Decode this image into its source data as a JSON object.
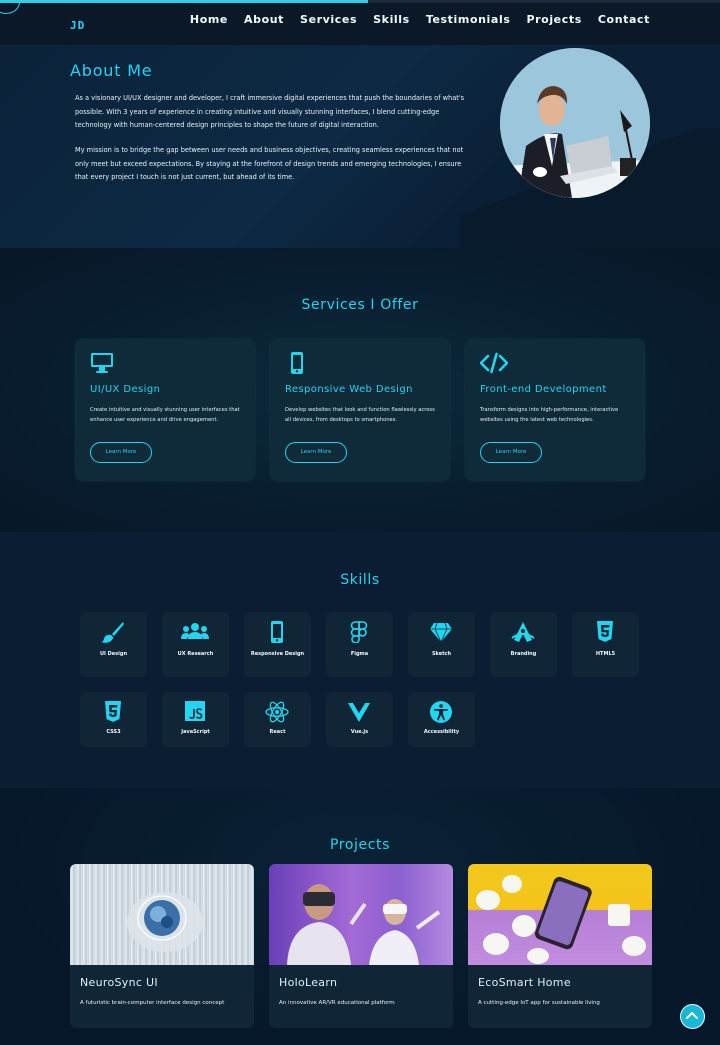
{
  "header": {
    "logo": "JD",
    "nav": [
      "Home",
      "About",
      "Services",
      "Skills",
      "Testimonials",
      "Projects",
      "Contact"
    ]
  },
  "about": {
    "title": "About Me",
    "p1": "As a visionary UI/UX designer and developer, I craft immersive digital experiences that push the boundaries of what's possible. With 3 years of experience in creating intuitive and visually stunning interfaces, I blend cutting-edge technology with human-centered design principles to shape the future of digital interaction.",
    "p2": "My mission is to bridge the gap between user needs and business objectives, creating seamless experiences that not only meet but exceed expectations. By staying at the forefront of design trends and emerging technologies, I ensure that every project I touch is not just current, but ahead of its time."
  },
  "services": {
    "title": "Services I Offer",
    "items": [
      {
        "icon": "desktop-icon",
        "title": "UI/UX Design",
        "desc": "Create intuitive and visually stunning user interfaces that enhance user experience and drive engagement.",
        "button": "Learn More"
      },
      {
        "icon": "mobile-icon",
        "title": "Responsive Web Design",
        "desc": "Develop websites that look and function flawlessly across all devices, from desktops to smartphones.",
        "button": "Learn More"
      },
      {
        "icon": "code-icon",
        "title": "Front-end Development",
        "desc": "Transform designs into high-performance, interactive websites using the latest web technologies.",
        "button": "Learn More"
      }
    ]
  },
  "skills": {
    "title": "Skills",
    "items": [
      {
        "label": "UI Design",
        "icon": "brush-icon"
      },
      {
        "label": "UX Research",
        "icon": "users-icon"
      },
      {
        "label": "Responsive Design",
        "icon": "mobile-icon"
      },
      {
        "label": "Figma",
        "icon": "figma-icon"
      },
      {
        "label": "Sketch",
        "icon": "gem-icon"
      },
      {
        "label": "Branding",
        "icon": "pen-nib-icon"
      },
      {
        "label": "HTML5",
        "icon": "html5-icon"
      },
      {
        "label": "CSS3",
        "icon": "css3-icon"
      },
      {
        "label": "JavaScript",
        "icon": "js-icon"
      },
      {
        "label": "React",
        "icon": "react-icon"
      },
      {
        "label": "Vue.js",
        "icon": "vue-icon"
      },
      {
        "label": "Accessibility",
        "icon": "accessibility-icon"
      }
    ]
  },
  "projects": {
    "title": "Projects",
    "items": [
      {
        "title": "NeuroSync UI",
        "desc": "A futuristic brain-computer interface design concept"
      },
      {
        "title": "HoloLearn",
        "desc": "An innovative AR/VR educational platform"
      },
      {
        "title": "EcoSmart Home",
        "desc": "A cutting-edge IoT app for sustainable living"
      }
    ]
  },
  "colors": {
    "accent": "#22d6f0",
    "background": "#07172a",
    "card": "#102536"
  }
}
